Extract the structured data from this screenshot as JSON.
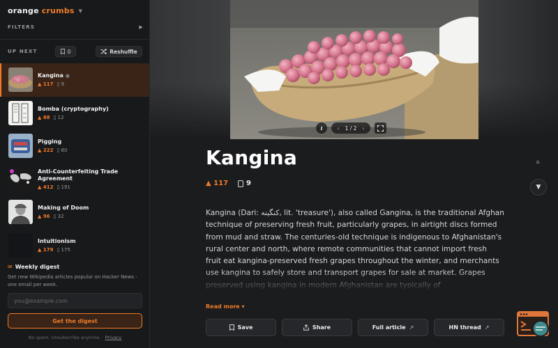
{
  "app": {
    "logo_part1": "orange",
    "logo_part2": "crumbs"
  },
  "sidebar": {
    "filters_label": "FILTERS",
    "upnext_label": "UP NEXT",
    "saved_count": "0",
    "reshuffle_label": "Reshuffle",
    "items": [
      {
        "title": "Kangina",
        "points": "117",
        "comments": "9",
        "active": true
      },
      {
        "title": "Bomba (cryptography)",
        "points": "88",
        "comments": "12"
      },
      {
        "title": "Pigging",
        "points": "222",
        "comments": "80"
      },
      {
        "title": "Anti-Counterfeiting Trade Agreement",
        "points": "412",
        "comments": "191"
      },
      {
        "title": "Making of Doom",
        "points": "96",
        "comments": "32"
      },
      {
        "title": "Intuitionism",
        "points": "179",
        "comments": "175"
      }
    ],
    "digest": {
      "title": "Weekly digest",
      "description": "Get new Wikipedia articles popular on Hacker News - one email per week.",
      "email_placeholder": "you@example.com",
      "button_label": "Get the digest",
      "fineprint": "No spam. Unsubscribe anytime.",
      "privacy_label": "Privacy"
    }
  },
  "article": {
    "image_pager": "1 / 2",
    "title": "Kangina",
    "points": "117",
    "comments": "9",
    "body": "Kangina (Dari: کنگینه, lit. 'treasure'), also called Gangina, is the traditional Afghan technique of preserving fresh fruit, particularly grapes, in airtight discs formed from mud and straw. The centuries-old technique is indigenous to Afghanistan's rural center and north, where remote communities that cannot import fresh fruit eat kangina-preserved fresh grapes throughout the winter, and merchants use kangina to safely store and transport grapes for sale at market. Grapes preserved using kangina in modern Afghanistan are typically of",
    "read_more": "Read more",
    "actions": {
      "save": "Save",
      "share": "Share",
      "full_article": "Full article",
      "hn_thread": "HN thread"
    }
  },
  "colors": {
    "accent": "#f07b2a",
    "background": "#1b1c1e",
    "sidebar": "#18191b"
  }
}
